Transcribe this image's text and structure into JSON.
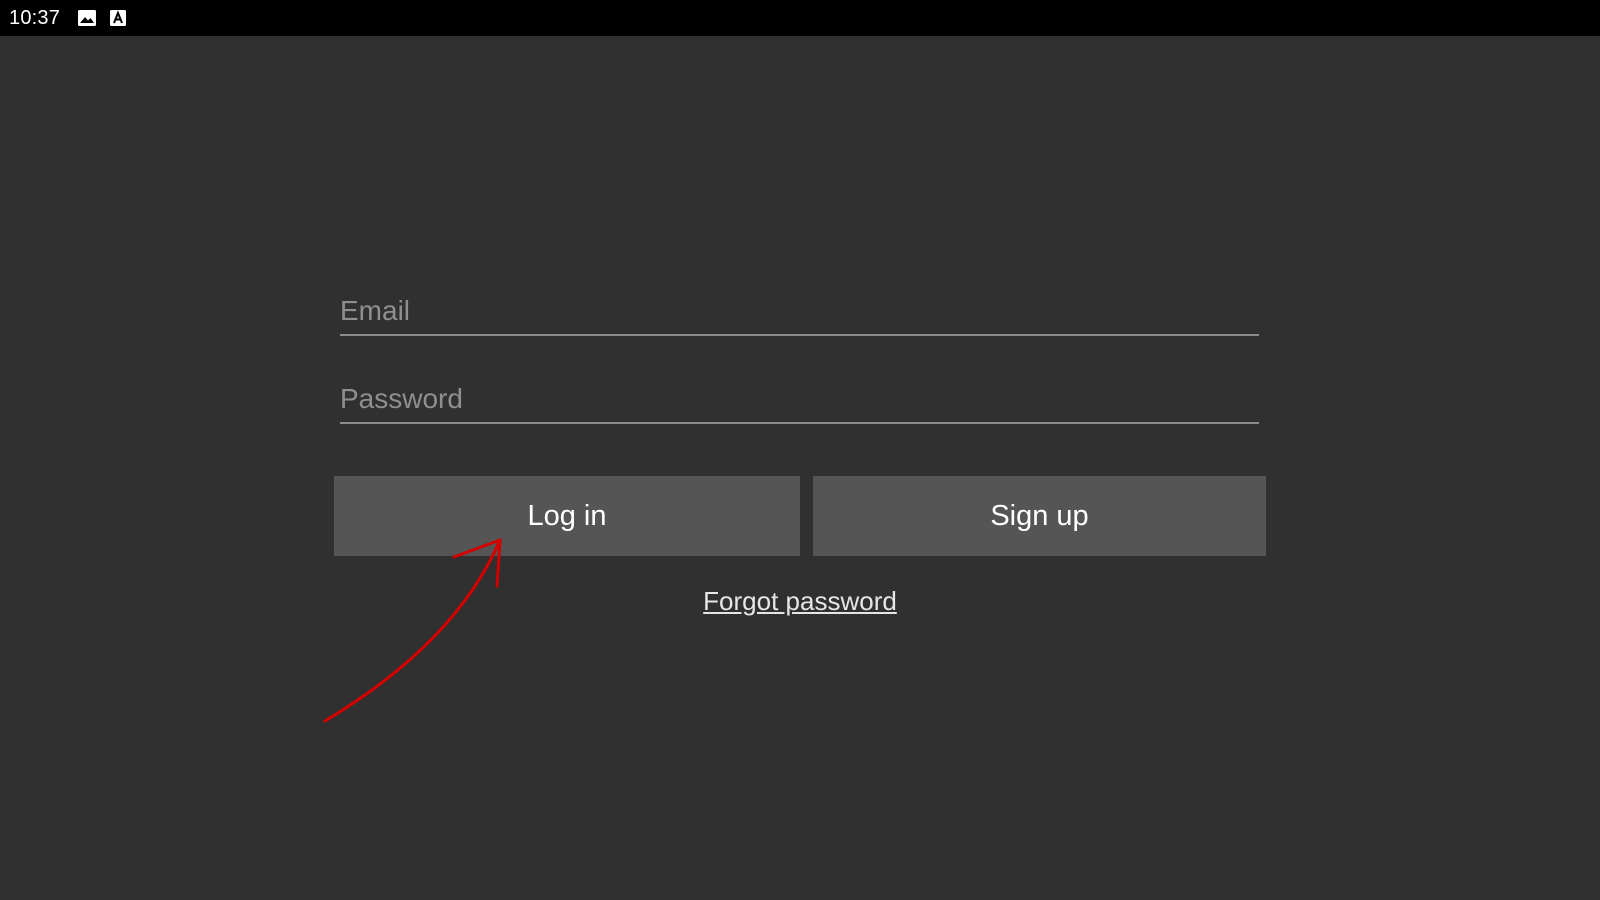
{
  "status_bar": {
    "time": "10:37",
    "icons": [
      "image-icon",
      "font-a-icon"
    ]
  },
  "form": {
    "email_placeholder": "Email",
    "email_value": "",
    "password_placeholder": "Password",
    "password_value": ""
  },
  "buttons": {
    "login_label": "Log in",
    "signup_label": "Sign up"
  },
  "links": {
    "forgot_password": "Forgot password"
  },
  "colors": {
    "background": "#303030",
    "status_bar": "#000000",
    "button": "#555555",
    "annotation": "#d40000"
  }
}
